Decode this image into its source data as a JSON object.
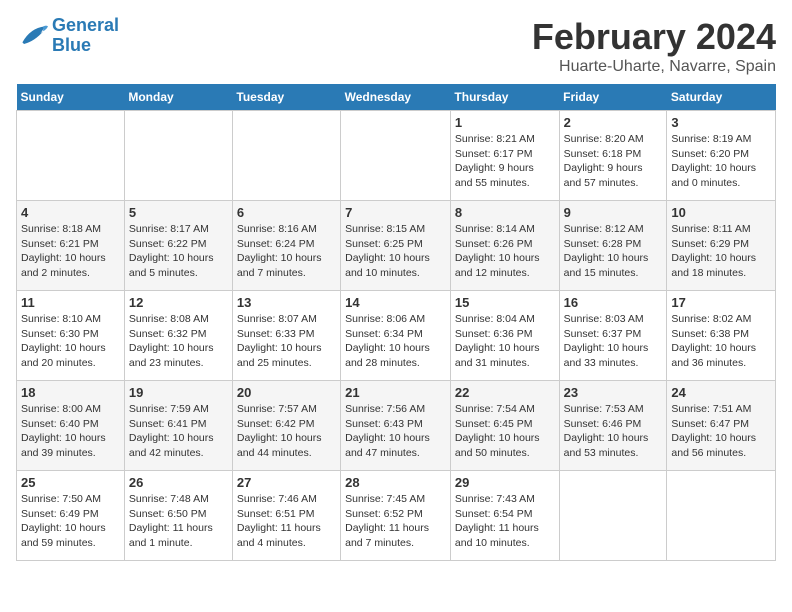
{
  "header": {
    "logo_line1": "General",
    "logo_line2": "Blue",
    "month": "February 2024",
    "location": "Huarte-Uharte, Navarre, Spain"
  },
  "weekdays": [
    "Sunday",
    "Monday",
    "Tuesday",
    "Wednesday",
    "Thursday",
    "Friday",
    "Saturday"
  ],
  "weeks": [
    [
      {
        "day": "",
        "info": ""
      },
      {
        "day": "",
        "info": ""
      },
      {
        "day": "",
        "info": ""
      },
      {
        "day": "",
        "info": ""
      },
      {
        "day": "1",
        "info": "Sunrise: 8:21 AM\nSunset: 6:17 PM\nDaylight: 9 hours\nand 55 minutes."
      },
      {
        "day": "2",
        "info": "Sunrise: 8:20 AM\nSunset: 6:18 PM\nDaylight: 9 hours\nand 57 minutes."
      },
      {
        "day": "3",
        "info": "Sunrise: 8:19 AM\nSunset: 6:20 PM\nDaylight: 10 hours\nand 0 minutes."
      }
    ],
    [
      {
        "day": "4",
        "info": "Sunrise: 8:18 AM\nSunset: 6:21 PM\nDaylight: 10 hours\nand 2 minutes."
      },
      {
        "day": "5",
        "info": "Sunrise: 8:17 AM\nSunset: 6:22 PM\nDaylight: 10 hours\nand 5 minutes."
      },
      {
        "day": "6",
        "info": "Sunrise: 8:16 AM\nSunset: 6:24 PM\nDaylight: 10 hours\nand 7 minutes."
      },
      {
        "day": "7",
        "info": "Sunrise: 8:15 AM\nSunset: 6:25 PM\nDaylight: 10 hours\nand 10 minutes."
      },
      {
        "day": "8",
        "info": "Sunrise: 8:14 AM\nSunset: 6:26 PM\nDaylight: 10 hours\nand 12 minutes."
      },
      {
        "day": "9",
        "info": "Sunrise: 8:12 AM\nSunset: 6:28 PM\nDaylight: 10 hours\nand 15 minutes."
      },
      {
        "day": "10",
        "info": "Sunrise: 8:11 AM\nSunset: 6:29 PM\nDaylight: 10 hours\nand 18 minutes."
      }
    ],
    [
      {
        "day": "11",
        "info": "Sunrise: 8:10 AM\nSunset: 6:30 PM\nDaylight: 10 hours\nand 20 minutes."
      },
      {
        "day": "12",
        "info": "Sunrise: 8:08 AM\nSunset: 6:32 PM\nDaylight: 10 hours\nand 23 minutes."
      },
      {
        "day": "13",
        "info": "Sunrise: 8:07 AM\nSunset: 6:33 PM\nDaylight: 10 hours\nand 25 minutes."
      },
      {
        "day": "14",
        "info": "Sunrise: 8:06 AM\nSunset: 6:34 PM\nDaylight: 10 hours\nand 28 minutes."
      },
      {
        "day": "15",
        "info": "Sunrise: 8:04 AM\nSunset: 6:36 PM\nDaylight: 10 hours\nand 31 minutes."
      },
      {
        "day": "16",
        "info": "Sunrise: 8:03 AM\nSunset: 6:37 PM\nDaylight: 10 hours\nand 33 minutes."
      },
      {
        "day": "17",
        "info": "Sunrise: 8:02 AM\nSunset: 6:38 PM\nDaylight: 10 hours\nand 36 minutes."
      }
    ],
    [
      {
        "day": "18",
        "info": "Sunrise: 8:00 AM\nSunset: 6:40 PM\nDaylight: 10 hours\nand 39 minutes."
      },
      {
        "day": "19",
        "info": "Sunrise: 7:59 AM\nSunset: 6:41 PM\nDaylight: 10 hours\nand 42 minutes."
      },
      {
        "day": "20",
        "info": "Sunrise: 7:57 AM\nSunset: 6:42 PM\nDaylight: 10 hours\nand 44 minutes."
      },
      {
        "day": "21",
        "info": "Sunrise: 7:56 AM\nSunset: 6:43 PM\nDaylight: 10 hours\nand 47 minutes."
      },
      {
        "day": "22",
        "info": "Sunrise: 7:54 AM\nSunset: 6:45 PM\nDaylight: 10 hours\nand 50 minutes."
      },
      {
        "day": "23",
        "info": "Sunrise: 7:53 AM\nSunset: 6:46 PM\nDaylight: 10 hours\nand 53 minutes."
      },
      {
        "day": "24",
        "info": "Sunrise: 7:51 AM\nSunset: 6:47 PM\nDaylight: 10 hours\nand 56 minutes."
      }
    ],
    [
      {
        "day": "25",
        "info": "Sunrise: 7:50 AM\nSunset: 6:49 PM\nDaylight: 10 hours\nand 59 minutes."
      },
      {
        "day": "26",
        "info": "Sunrise: 7:48 AM\nSunset: 6:50 PM\nDaylight: 11 hours\nand 1 minute."
      },
      {
        "day": "27",
        "info": "Sunrise: 7:46 AM\nSunset: 6:51 PM\nDaylight: 11 hours\nand 4 minutes."
      },
      {
        "day": "28",
        "info": "Sunrise: 7:45 AM\nSunset: 6:52 PM\nDaylight: 11 hours\nand 7 minutes."
      },
      {
        "day": "29",
        "info": "Sunrise: 7:43 AM\nSunset: 6:54 PM\nDaylight: 11 hours\nand 10 minutes."
      },
      {
        "day": "",
        "info": ""
      },
      {
        "day": "",
        "info": ""
      }
    ]
  ]
}
